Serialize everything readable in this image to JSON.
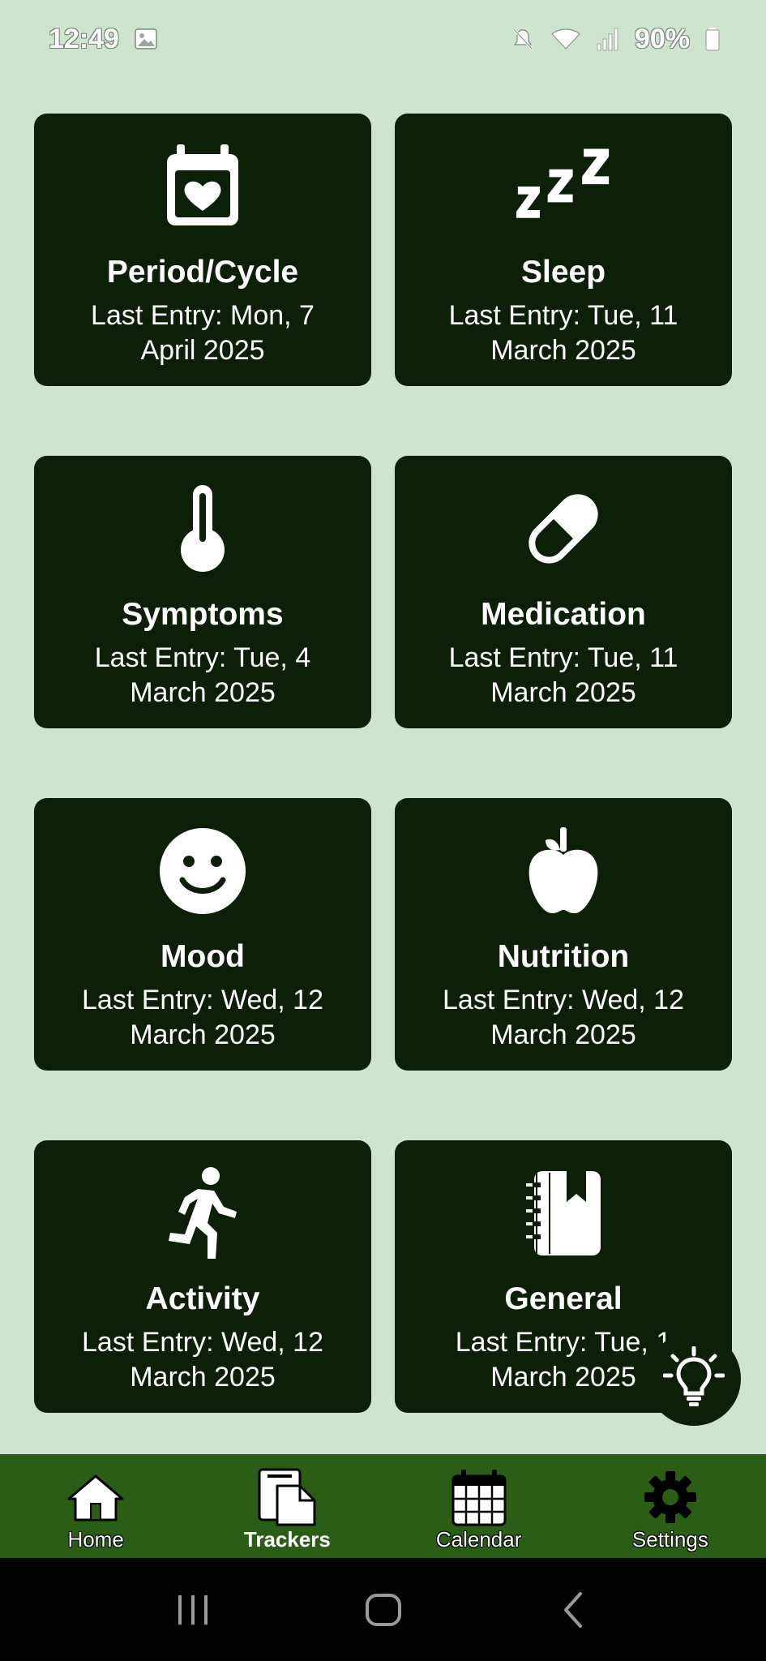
{
  "status_bar": {
    "time": "12:49",
    "battery": "90%"
  },
  "trackers": [
    {
      "title": "Period/Cycle",
      "entry": "Last Entry: Mon, 7 April 2025",
      "icon": "calendar-heart-icon"
    },
    {
      "title": "Sleep",
      "entry": "Last Entry: Tue, 11 March 2025",
      "icon": "zzz-icon"
    },
    {
      "title": "Symptoms",
      "entry": "Last Entry: Tue, 4 March 2025",
      "icon": "thermometer-icon"
    },
    {
      "title": "Medication",
      "entry": "Last Entry: Tue, 11 March 2025",
      "icon": "pill-icon"
    },
    {
      "title": "Mood",
      "entry": "Last Entry: Wed, 12 March 2025",
      "icon": "smiley-icon"
    },
    {
      "title": "Nutrition",
      "entry": "Last Entry: Wed, 12 March 2025",
      "icon": "apple-icon"
    },
    {
      "title": "Activity",
      "entry": "Last Entry: Wed, 12 March 2025",
      "icon": "running-icon"
    },
    {
      "title": "General",
      "entry": "Last Entry: Tue, 1 March 2025",
      "icon": "notebook-icon"
    }
  ],
  "bottom_nav": {
    "items": [
      {
        "label": "Home",
        "icon": "home-icon"
      },
      {
        "label": "Trackers",
        "icon": "trackers-icon"
      },
      {
        "label": "Calendar",
        "icon": "calendar-icon"
      },
      {
        "label": "Settings",
        "icon": "gear-icon"
      }
    ],
    "active": "Trackers"
  },
  "colors": {
    "background": "#cde5cc",
    "card": "#0b2007",
    "nav": "#2a5e16"
  }
}
